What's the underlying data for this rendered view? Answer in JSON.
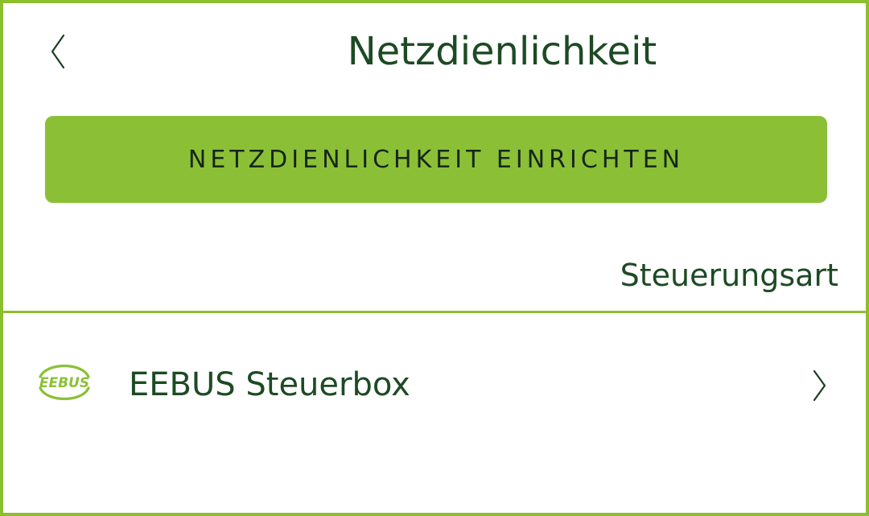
{
  "header": {
    "title": "Netzdienlichkeit",
    "back_icon": "chevron-left-icon"
  },
  "actions": {
    "setup_button_label": "NETZDIENLICHKEIT EINRICHTEN"
  },
  "section": {
    "label": "Steuerungsart"
  },
  "list": {
    "items": [
      {
        "label": "EEBUS Steuerbox",
        "logo_text": "EEBUS",
        "icon": "eebus-logo-icon",
        "trailing_icon": "chevron-right-icon"
      }
    ]
  },
  "colors": {
    "accent": "#8bc036",
    "border": "#8cbf2c",
    "text": "#1d4a24",
    "button_text": "#16261a"
  }
}
